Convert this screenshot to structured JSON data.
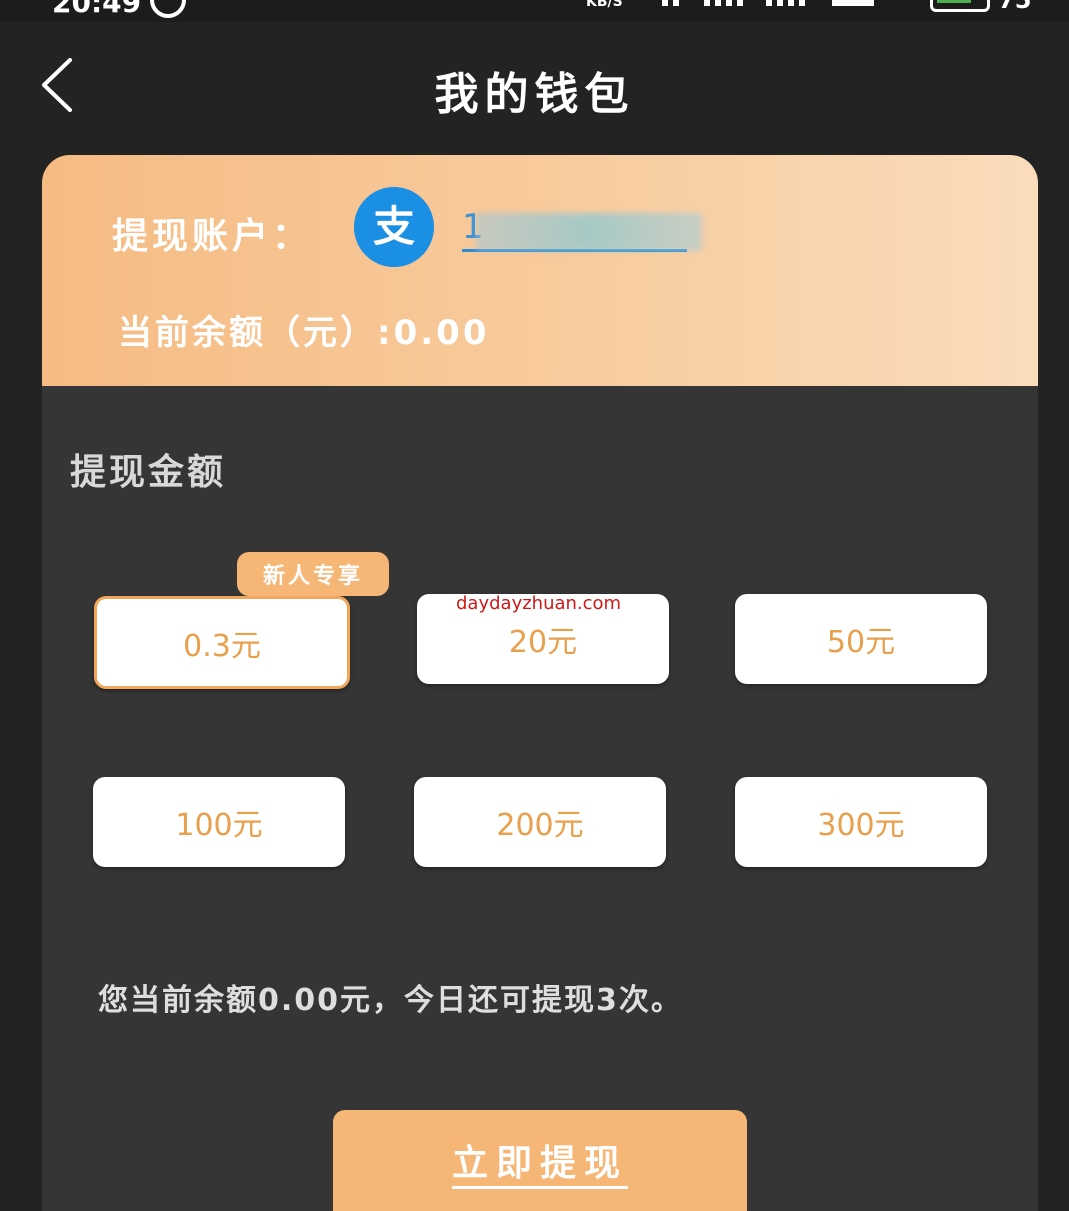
{
  "status_bar": {
    "time": "20:49",
    "speed_unit": "KB/S",
    "battery": "75"
  },
  "header": {
    "title": "我的钱包"
  },
  "account": {
    "label": "提现账户：",
    "value": "1",
    "icon": "alipay-icon",
    "icon_glyph": "支",
    "icon_color": "#1a8fe3"
  },
  "balance": {
    "text": "当前余额（元）:0.00"
  },
  "withdraw_amount": {
    "title": "提现金额",
    "badge": "新人专享",
    "options": [
      {
        "label": "0.3元",
        "selected": true
      },
      {
        "label": "20元",
        "selected": false
      },
      {
        "label": "50元",
        "selected": false
      },
      {
        "label": "100元",
        "selected": false
      },
      {
        "label": "200元",
        "selected": false
      },
      {
        "label": "300元",
        "selected": false
      }
    ]
  },
  "watermark": "daydayzhuan.com",
  "info": "您当前余额0.00元，今日还可提现3次。",
  "submit": {
    "label": "立即提现"
  },
  "colors": {
    "accent": "#f5b676",
    "amount_text": "#e8a04c",
    "background": "#232323",
    "card": "#353535"
  }
}
